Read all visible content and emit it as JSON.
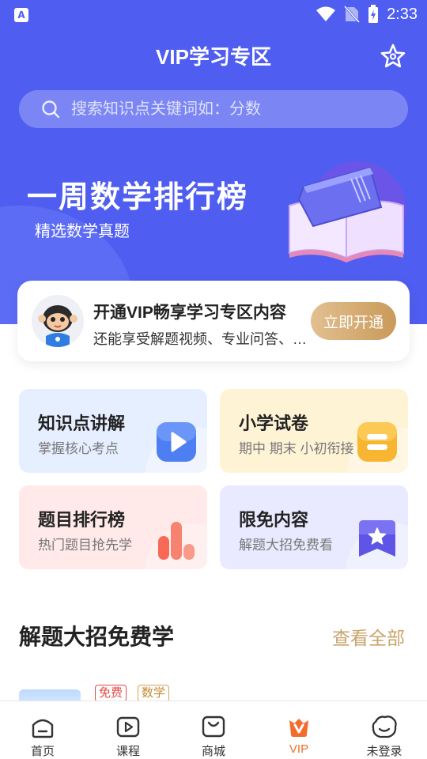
{
  "status_bar": {
    "time": "2:33",
    "app_icon_letter": "A"
  },
  "header": {
    "title": "VIP学习专区",
    "favorite_icon": "star-outline-icon"
  },
  "search": {
    "placeholder": "搜索知识点关键词如：分数",
    "icon": "search-icon"
  },
  "banner": {
    "title": "一周数学排行榜",
    "subtitle": "精选数学真题",
    "illustration": "open-book-illustration"
  },
  "vip_card": {
    "title": "开通VIP畅享学习专区内容",
    "description": "还能享受解题视频、专业问答、…",
    "button_label": "立即开通"
  },
  "tiles": [
    {
      "title": "知识点讲解",
      "subtitle": "掌握核心考点",
      "icon": "video-play-icon",
      "bg": "#e6efff"
    },
    {
      "title": "小学试卷",
      "subtitle": "期中 期末 小初衔接",
      "icon": "exam-paper-icon",
      "bg": "#fff3d6"
    },
    {
      "title": "题目排行榜",
      "subtitle": "热门题目抢先学",
      "icon": "bar-chart-icon",
      "bg": "#ffe9e9"
    },
    {
      "title": "限免内容",
      "subtitle": "解题大招免费看",
      "icon": "star-badge-icon",
      "bg": "#e9eaff"
    }
  ],
  "section": {
    "title": "解题大招免费学",
    "see_all": "查看全部"
  },
  "list_item": {
    "tags": [
      "免费",
      "数学"
    ]
  },
  "tabbar": {
    "items": [
      {
        "label": "首页",
        "icon": "home-icon"
      },
      {
        "label": "课程",
        "icon": "course-play-icon"
      },
      {
        "label": "商城",
        "icon": "shop-bag-icon"
      },
      {
        "label": "VIP",
        "icon": "vip-crown-icon"
      },
      {
        "label": "未登录",
        "icon": "user-avatar-icon"
      }
    ],
    "active": "VIP"
  },
  "colors": {
    "primary": "#4f5ef0",
    "gold": "#c9a46a",
    "active_tab": "#f26d2d",
    "tag_red": "#e24a4a"
  }
}
